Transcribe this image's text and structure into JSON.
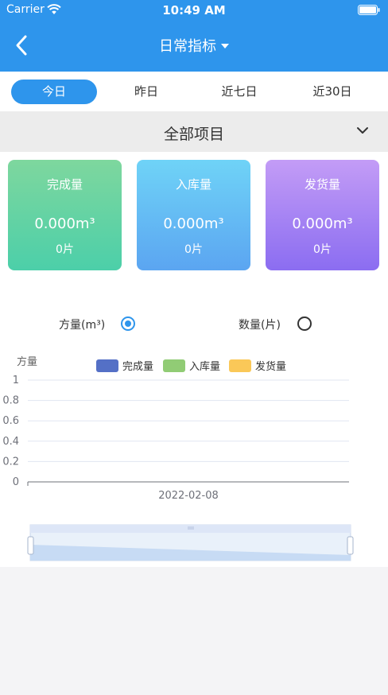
{
  "status": {
    "carrier": "Carrier",
    "time": "10:49 AM"
  },
  "nav": {
    "title": "日常指标"
  },
  "tabs": [
    {
      "label": "今日",
      "active": true
    },
    {
      "label": "昨日",
      "active": false
    },
    {
      "label": "近七日",
      "active": false
    },
    {
      "label": "近30日",
      "active": false
    }
  ],
  "filter": {
    "label": "全部项目"
  },
  "cards": [
    {
      "title": "完成量",
      "volume": "0.000m³",
      "count": "0片"
    },
    {
      "title": "入库量",
      "volume": "0.000m³",
      "count": "0片"
    },
    {
      "title": "发货量",
      "volume": "0.000m³",
      "count": "0片"
    }
  ],
  "toggle": {
    "volume_label": "方量(m³)",
    "volume_selected": true,
    "count_label": "数量(片)",
    "count_selected": false
  },
  "colors": {
    "primary": "#2e95ec",
    "series1": "#5470c6",
    "series2": "#91cc75",
    "series3": "#fac858"
  },
  "chart_data": {
    "type": "bar",
    "ylabel": "方量",
    "categories": [
      "2022-02-08"
    ],
    "series": [
      {
        "name": "完成量",
        "values": [
          0
        ]
      },
      {
        "name": "入库量",
        "values": [
          0
        ]
      },
      {
        "name": "发货量",
        "values": [
          0
        ]
      }
    ],
    "ylim": [
      0,
      1
    ],
    "yticks": [
      "0",
      "0.2",
      "0.4",
      "0.6",
      "0.8",
      "1"
    ],
    "grid": true,
    "legend": "top"
  }
}
